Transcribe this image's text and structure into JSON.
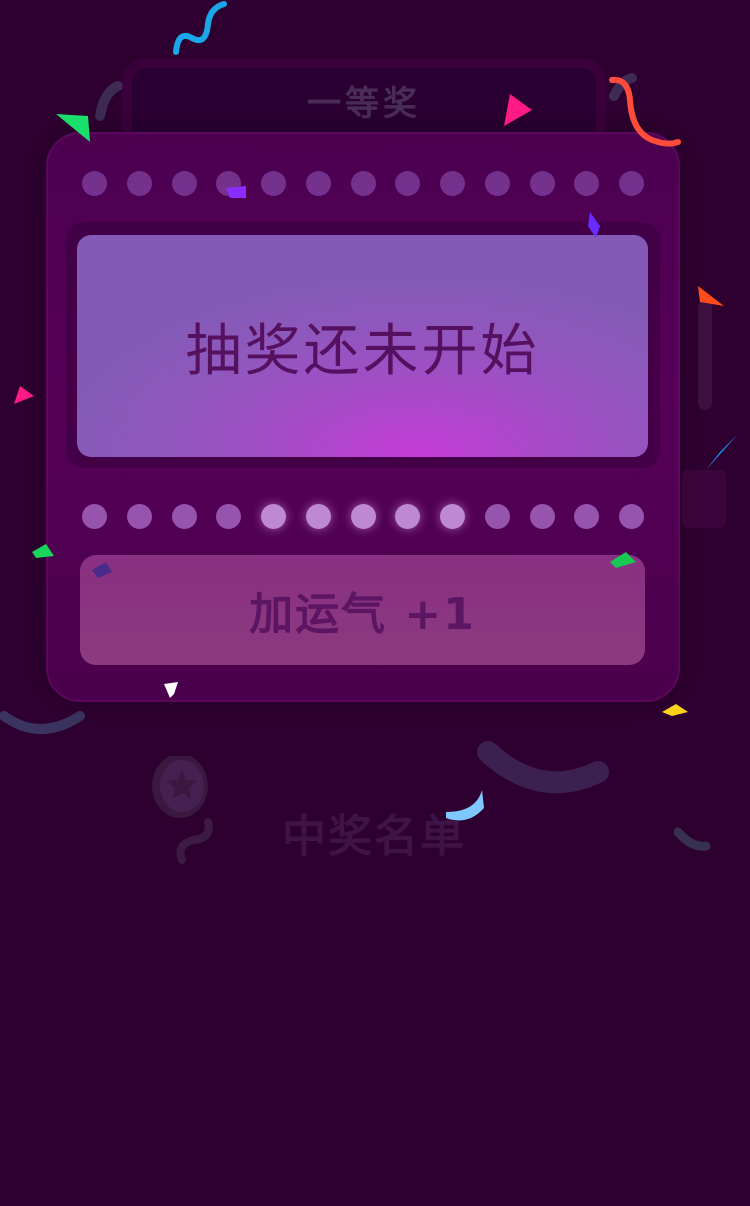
{
  "prize": {
    "title": "一等奖"
  },
  "screen": {
    "message": "抽奖还未开始"
  },
  "actions": {
    "luck_label": "加运气 +1"
  },
  "winners": {
    "title": "中奖名单"
  },
  "colors": {
    "background": "#2e0030",
    "machine": "#560058",
    "screen": "#a44cc6",
    "button": "#8a2f83"
  },
  "icons": {
    "medal": "medal-icon",
    "confetti": "confetti"
  }
}
